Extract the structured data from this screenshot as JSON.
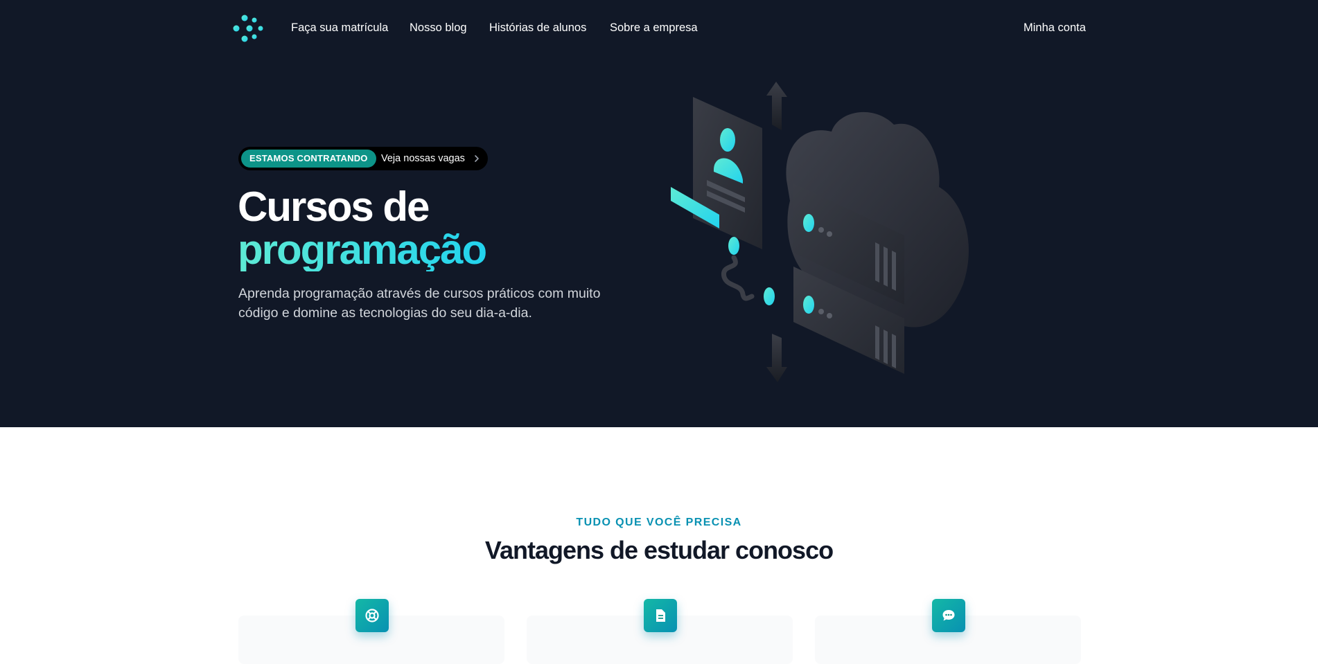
{
  "nav": {
    "links": [
      {
        "label": "Faça sua matrícula"
      },
      {
        "label": "Nosso blog"
      },
      {
        "label": "Histórias de alunos"
      },
      {
        "label": "Sobre a empresa"
      }
    ],
    "account_label": "Minha conta"
  },
  "hero": {
    "badge": {
      "pill_label": "ESTAMOS CONTRATANDO",
      "link_label": "Veja nossas vagas"
    },
    "title_line1": "Cursos de",
    "title_line2": "programação",
    "subtitle": "Aprenda programação através de cursos práticos com muito código e domine as tecnologias do seu dia-a-dia."
  },
  "features": {
    "eyebrow": "TUDO QUE VOCÊ PRECISA",
    "title": "Vantagens de estudar conosco",
    "cards": [
      {
        "icon": "support-icon"
      },
      {
        "icon": "document-icon"
      },
      {
        "icon": "chat-icon"
      }
    ]
  },
  "colors": {
    "hero_bg": "#111827",
    "accent_teal": "#0d9488",
    "accent_cyan": "#22d3ee",
    "eyebrow": "#0891b2"
  }
}
